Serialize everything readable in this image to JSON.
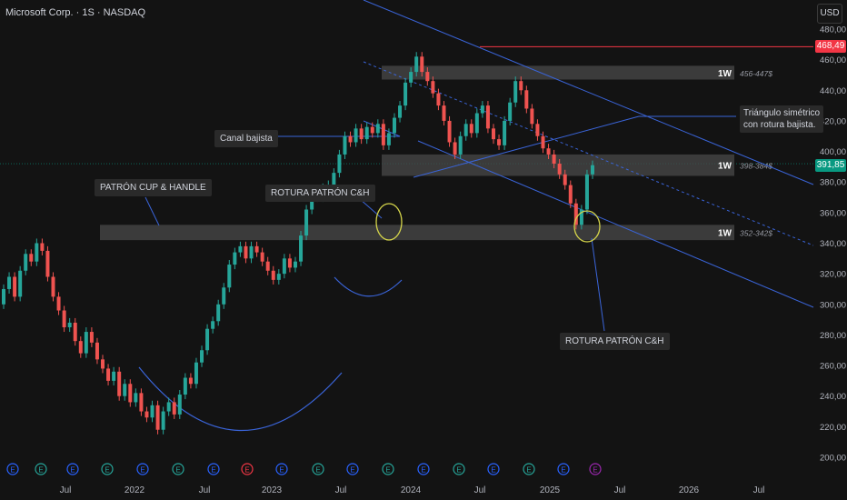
{
  "header": {
    "title": "Microsoft Corp. · 1S · NASDAQ",
    "currency": "USD"
  },
  "price_axis": {
    "ticks": [
      "480,00",
      "460,00",
      "440,00",
      "420,00",
      "400,00",
      "380,00",
      "360,00",
      "340,00",
      "320,00",
      "300,00",
      "280,00",
      "260,00",
      "240,00",
      "220,00",
      "200,00"
    ],
    "last_price": "391,85",
    "high_price": "468,49"
  },
  "time_axis": {
    "ticks": [
      "Jul",
      "2022",
      "Jul",
      "2023",
      "Jul",
      "2024",
      "Jul",
      "2025",
      "Jul",
      "2026",
      "Jul"
    ]
  },
  "zones": [
    {
      "label": "1W",
      "range": "456-447$"
    },
    {
      "label": "1W",
      "range": "398-384$"
    },
    {
      "label": "1W",
      "range": "352-342$"
    }
  ],
  "annotations": {
    "canal": "Canal bajista",
    "cup_handle": "PATRÓN CUP & HANDLE",
    "rotura_1": "ROTURA PATRÓN C&H",
    "rotura_2": "ROTURA PATRÓN C&H",
    "triangulo_line1": "Triángulo simétrico",
    "triangulo_line2": "con rotura bajista."
  },
  "events": [
    "E",
    "E",
    "E",
    "E",
    "E",
    "E",
    "E",
    "E",
    "E",
    "E",
    "E",
    "E",
    "E",
    "E",
    "E",
    "E",
    "E",
    "E",
    "E",
    "E",
    "E"
  ],
  "chart_data": {
    "type": "candlestick",
    "series": [
      {
        "values": [
          [
            300,
            310
          ],
          [
            310,
            318
          ],
          [
            318,
            305
          ],
          [
            305,
            322
          ],
          [
            322,
            333
          ],
          [
            333,
            328
          ],
          [
            328,
            340
          ],
          [
            340,
            335
          ],
          [
            335,
            318
          ],
          [
            318,
            305
          ],
          [
            305,
            296
          ],
          [
            296,
            285
          ],
          [
            285,
            288
          ],
          [
            288,
            276
          ],
          [
            276,
            268
          ],
          [
            268,
            282
          ],
          [
            282,
            275
          ],
          [
            275,
            264
          ],
          [
            264,
            258
          ],
          [
            258,
            250
          ],
          [
            250,
            256
          ],
          [
            256,
            240
          ],
          [
            240,
            248
          ],
          [
            248,
            236
          ],
          [
            236,
            242
          ],
          [
            242,
            230
          ],
          [
            230,
            226
          ],
          [
            226,
            234
          ],
          [
            234,
            218
          ],
          [
            218,
            230
          ],
          [
            230,
            236
          ],
          [
            236,
            228
          ],
          [
            228,
            241
          ],
          [
            241,
            252
          ],
          [
            252,
            248
          ],
          [
            248,
            262
          ],
          [
            262,
            270
          ],
          [
            270,
            284
          ],
          [
            284,
            289
          ],
          [
            289,
            300
          ],
          [
            300,
            311
          ],
          [
            311,
            326
          ],
          [
            326,
            334
          ],
          [
            334,
            338
          ],
          [
            338,
            330
          ],
          [
            330,
            338
          ],
          [
            338,
            334
          ],
          [
            334,
            328
          ],
          [
            328,
            322
          ],
          [
            322,
            316
          ],
          [
            316,
            320
          ],
          [
            320,
            330
          ],
          [
            330,
            324
          ],
          [
            324,
            328
          ],
          [
            328,
            345
          ],
          [
            345,
            362
          ],
          [
            362,
            375
          ],
          [
            375,
            370
          ],
          [
            370,
            376
          ],
          [
            376,
            378
          ],
          [
            378,
            386
          ],
          [
            386,
            398
          ],
          [
            398,
            410
          ],
          [
            410,
            406
          ],
          [
            406,
            415
          ],
          [
            415,
            408
          ],
          [
            408,
            416
          ],
          [
            416,
            412
          ],
          [
            412,
            418
          ],
          [
            418,
            404
          ],
          [
            404,
            412
          ],
          [
            412,
            422
          ],
          [
            422,
            430
          ],
          [
            430,
            445
          ],
          [
            445,
            452
          ],
          [
            452,
            462
          ],
          [
            462,
            452
          ],
          [
            452,
            446
          ],
          [
            446,
            438
          ],
          [
            438,
            430
          ],
          [
            430,
            420
          ],
          [
            420,
            406
          ],
          [
            406,
            398
          ],
          [
            398,
            410
          ],
          [
            410,
            418
          ],
          [
            418,
            412
          ],
          [
            412,
            425
          ],
          [
            425,
            430
          ],
          [
            430,
            415
          ],
          [
            415,
            408
          ],
          [
            408,
            404
          ],
          [
            404,
            420
          ],
          [
            420,
            432
          ],
          [
            432,
            446
          ],
          [
            446,
            440
          ],
          [
            440,
            428
          ],
          [
            428,
            418
          ],
          [
            418,
            410
          ],
          [
            410,
            402
          ],
          [
            402,
            398
          ],
          [
            398,
            392
          ],
          [
            392,
            385
          ],
          [
            385,
            378
          ],
          [
            378,
            366
          ],
          [
            366,
            352
          ],
          [
            352,
            362
          ],
          [
            362,
            385
          ],
          [
            385,
            391
          ]
        ]
      }
    ],
    "ylim": [
      200,
      480
    ]
  }
}
